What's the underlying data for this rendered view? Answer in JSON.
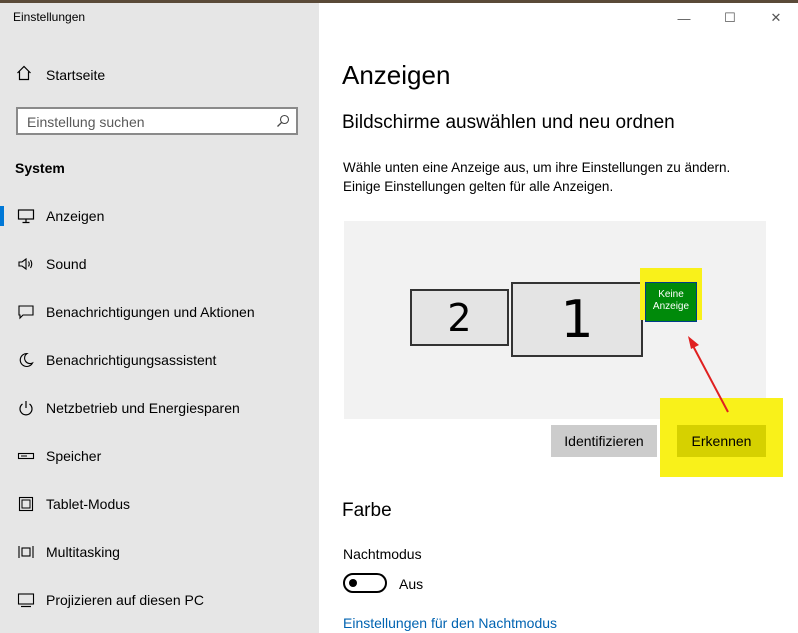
{
  "window": {
    "title": "Einstellungen",
    "minimize": "—",
    "maximize": "☐",
    "close": "✕"
  },
  "sidebar": {
    "home_label": "Startseite",
    "search_placeholder": "Einstellung suchen",
    "section_title": "System",
    "items": [
      {
        "label": "Anzeigen",
        "icon": "monitor-icon",
        "selected": true
      },
      {
        "label": "Sound",
        "icon": "speaker-icon"
      },
      {
        "label": "Benachrichtigungen und Aktionen",
        "icon": "notification-icon"
      },
      {
        "label": "Benachrichtigungsassistent",
        "icon": "moon-icon"
      },
      {
        "label": "Netzbetrieb und Energiesparen",
        "icon": "power-icon"
      },
      {
        "label": "Speicher",
        "icon": "storage-icon"
      },
      {
        "label": "Tablet-Modus",
        "icon": "tablet-icon"
      },
      {
        "label": "Multitasking",
        "icon": "multitasking-icon"
      },
      {
        "label": "Projizieren auf diesen PC",
        "icon": "projection-icon"
      }
    ]
  },
  "main": {
    "title": "Anzeigen",
    "subtitle": "Bildschirme auswählen und neu ordnen",
    "description_line1": "Wähle unten eine Anzeige aus, um ihre Einstellungen zu ändern.",
    "description_line2": "Einige Einstellungen gelten für alle Anzeigen.",
    "monitors": [
      {
        "label": "2"
      },
      {
        "label": "1"
      }
    ],
    "no_display_line1": "Keine",
    "no_display_line2": "Anzeige",
    "identify_button": "Identifizieren",
    "detect_button": "Erkennen",
    "color_heading": "Farbe",
    "night_mode_label": "Nachtmodus",
    "night_mode_state": "Aus",
    "night_mode_settings_link": "Einstellungen für den Nachtmodus"
  },
  "colors": {
    "accent": "#0078d7",
    "highlight": "#f9f11a",
    "annotation_arrow": "#e02020",
    "no_display_fill": "#008a0a"
  }
}
